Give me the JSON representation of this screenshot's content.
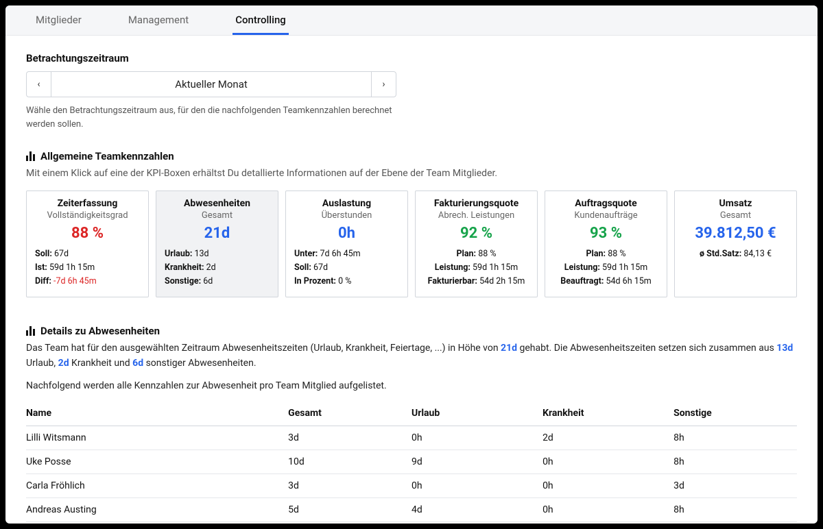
{
  "tabs": {
    "members": "Mitglieder",
    "management": "Management",
    "controlling": "Controlling"
  },
  "period": {
    "label": "Betrachtungszeitraum",
    "value": "Aktueller Monat",
    "help": "Wähle den Betrachtungszeitraum aus, für den die nachfolgenden Teamkennzahlen berechnet werden sollen."
  },
  "kpi_section": {
    "heading": "Allgemeine Teamkennzahlen",
    "desc": "Mit einem Klick auf eine der KPI-Boxen erhältst Du detallierte Informationen auf der Ebene der Team Mitglieder."
  },
  "kpis": {
    "zeiterfassung": {
      "title": "Zeiterfassung",
      "sub": "Vollständigkeitsgrad",
      "value": "88 %",
      "l1k": "Soll:",
      "l1v": "67d",
      "l2k": "Ist:",
      "l2v": "59d 1h 15m",
      "l3k": "Diff:",
      "l3v": "-7d 6h 45m"
    },
    "abwesenheiten": {
      "title": "Abwesenheiten",
      "sub": "Gesamt",
      "value": "21d",
      "l1k": "Urlaub:",
      "l1v": "13d",
      "l2k": "Krankheit:",
      "l2v": "2d",
      "l3k": "Sonstige:",
      "l3v": "6d"
    },
    "auslastung": {
      "title": "Auslastung",
      "sub": "Überstunden",
      "value": "0h",
      "l1k": "Unter:",
      "l1v": "7d 6h 45m",
      "l2k": "Soll:",
      "l2v": "67d",
      "l3k": "In Prozent:",
      "l3v": "0 %"
    },
    "fakturierung": {
      "title": "Fakturierungsquote",
      "sub": "Abrech. Leistungen",
      "value": "92 %",
      "l1k": "Plan:",
      "l1v": "88 %",
      "l2k": "Leistung:",
      "l2v": "59d 1h 15m",
      "l3k": "Fakturierbar:",
      "l3v": "54d 2h 15m"
    },
    "auftrag": {
      "title": "Auftragsquote",
      "sub": "Kundenaufträge",
      "value": "93 %",
      "l1k": "Plan:",
      "l1v": "88 %",
      "l2k": "Leistung:",
      "l2v": "59d 1h 15m",
      "l3k": "Beauftragt:",
      "l3v": "54d 6h 15m"
    },
    "umsatz": {
      "title": "Umsatz",
      "sub": "Gesamt",
      "value": "39.812,50 €",
      "l1k": "ø Std.Satz:",
      "l1v": "84,13 €"
    }
  },
  "details": {
    "heading": "Details zu Abwesenheiten",
    "p1a": "Das Team hat für den ausgewählten Zeitraum Abwesenheitszeiten (Urlaub, Krankheit, Feiertage, ...) in Höhe von ",
    "p1_v1": "21d",
    "p1b": " gehabt. Die Abwesenheitszeiten setzen sich zusammen aus ",
    "p1_v2": "13d",
    "p1c": " Urlaub, ",
    "p1_v3": "2d",
    "p1d": " Krankheit und ",
    "p1_v4": "6d",
    "p1e": " sonstiger Abwesenheiten.",
    "p2": "Nachfolgend werden alle Kennzahlen zur Abwesenheit pro Team Mitglied aufgelistet.",
    "cols": {
      "name": "Name",
      "gesamt": "Gesamt",
      "urlaub": "Urlaub",
      "krankheit": "Krankheit",
      "sonstige": "Sonstige"
    },
    "rows": [
      {
        "name": "Lilli Witsmann",
        "gesamt": "3d",
        "urlaub": "0h",
        "krankheit": "2d",
        "sonstige": "8h"
      },
      {
        "name": "Uke Posse",
        "gesamt": "10d",
        "urlaub": "9d",
        "krankheit": "0h",
        "sonstige": "8h"
      },
      {
        "name": "Carla Fröhlich",
        "gesamt": "3d",
        "urlaub": "0h",
        "krankheit": "0h",
        "sonstige": "3d"
      },
      {
        "name": "Andreas Austing",
        "gesamt": "5d",
        "urlaub": "4d",
        "krankheit": "0h",
        "sonstige": "8h"
      }
    ]
  }
}
